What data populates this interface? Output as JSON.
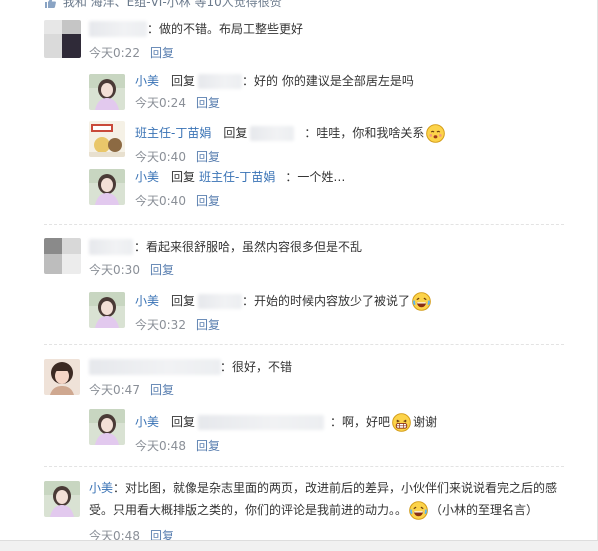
{
  "likes": {
    "prefix": "我和",
    "names": "海洋、E组-VI-小林",
    "suffix": "等10人觉得很赞"
  },
  "comments": [
    {
      "name": "",
      "text": "：做的不错。布局工整些更好",
      "time": "今天0:22",
      "reply": "回复"
    },
    {
      "name": "小美",
      "reply_word": "回复",
      "target": "",
      "text": "：好的 你的建议是全部居左是吗",
      "time": "今天0:24",
      "reply": "回复"
    },
    {
      "name": "班主任-丁苗娟",
      "reply_word": "回复",
      "target": "",
      "text": "：哇哇，你和我啥关系",
      "time": "今天0:40",
      "reply": "回复"
    },
    {
      "name": "小美",
      "reply_word": "回复",
      "target": "班主任-丁苗娟",
      "text": "：一个姓…",
      "time": "今天0:40",
      "reply": "回复"
    },
    {
      "name": "",
      "text": "：看起来很舒服哈，虽然内容很多但是不乱",
      "time": "今天0:30",
      "reply": "回复"
    },
    {
      "name": "小美",
      "reply_word": "回复",
      "target": "",
      "text": "：开始的时候内容放少了被说了",
      "time": "今天0:32",
      "reply": "回复"
    },
    {
      "name": "",
      "text": "：很好，不错",
      "time": "今天0:47",
      "reply": "回复"
    },
    {
      "name": "小美",
      "reply_word": "回复",
      "target": "",
      "text": "：啊，好吧",
      "text2": "谢谢",
      "time": "今天0:48",
      "reply": "回复"
    },
    {
      "name": "小美",
      "text_line1": "：对比图，就像是杂志里面的两页，改进前后的差异，小伙伴们来说说看完之后的感",
      "text_line2": "受。只用看大概排版之类的，你们的评论是我前进的动力。。",
      "text_line2b": "（小林的至理名言）",
      "time": "今天0:48",
      "reply": "回复"
    }
  ],
  "emoji": {
    "blush": "blush-emoji",
    "laugh": "laugh-cry-emoji",
    "grin": "grin-emoji"
  },
  "colors": {
    "name_link": "#3a73b5",
    "meta_gray": "#8a8f97",
    "reply_link": "#5a7fb0",
    "separator": "#e3e3e3"
  }
}
